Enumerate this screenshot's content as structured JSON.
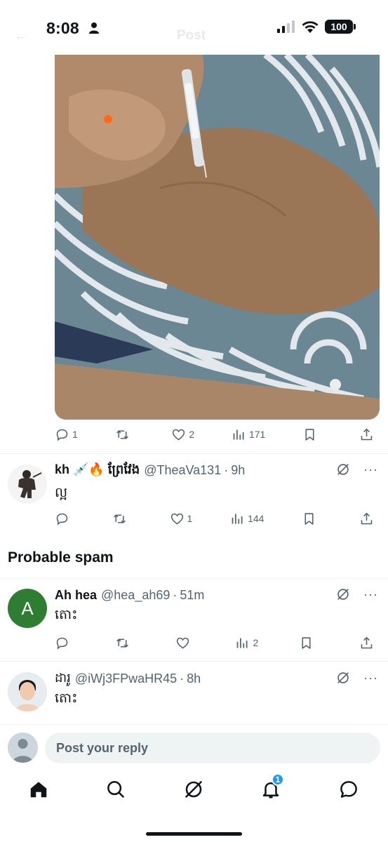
{
  "status_bar": {
    "time": "8:08",
    "battery": "100",
    "signal_icon": "signal-bars-icon",
    "wifi_icon": "wifi-icon"
  },
  "header_ghost": {
    "title": "Post"
  },
  "main_post": {
    "media_description_icon": "photo",
    "actions": {
      "replies": "1",
      "reposts": "",
      "likes": "2",
      "views": "171"
    }
  },
  "replies": [
    {
      "name": "kh 💉🔥 ព្រែវែង",
      "handle": "@TheaVa131",
      "time": "9h",
      "text": "ល្អ",
      "actions": {
        "replies": "",
        "reposts": "",
        "likes": "1",
        "views": "144"
      }
    }
  ],
  "spam_section": {
    "title": "Probable spam",
    "replies": [
      {
        "avatar_letter": "A",
        "avatar_color": "#2e7d32",
        "name": "Ah hea",
        "handle": "@hea_ah69",
        "time": "51m",
        "text": "តោះ",
        "actions": {
          "replies": "",
          "reposts": "",
          "likes": "",
          "views": "2"
        }
      },
      {
        "name": "ដារូ",
        "handle": "@iWj3FPwaHR45",
        "time": "8h",
        "text": "តោះ"
      }
    ]
  },
  "composer": {
    "placeholder": "Post your reply"
  },
  "tab_bar": {
    "tabs": [
      "home",
      "search",
      "grok",
      "notifications",
      "messages"
    ],
    "notifications_badge": "1"
  },
  "colors": {
    "accent": "#1d9bf0",
    "muted": "#536471",
    "text": "#0f1419"
  }
}
